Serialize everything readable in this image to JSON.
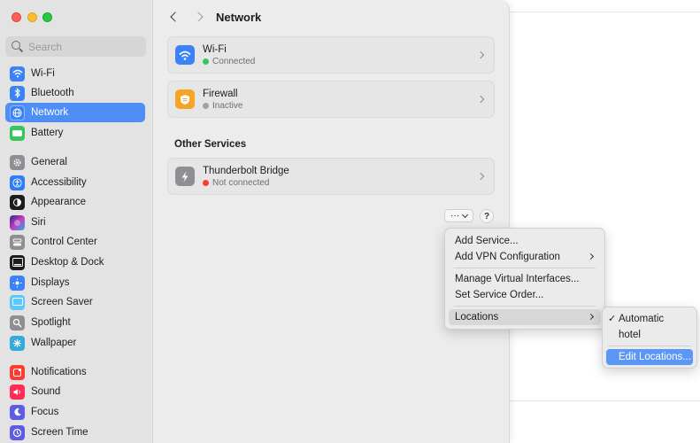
{
  "window": {
    "title": "Network"
  },
  "search": {
    "placeholder": "Search"
  },
  "sidebar": {
    "items": [
      {
        "label": "Wi-Fi",
        "icon": "wifi-icon",
        "color": "#3b82f6"
      },
      {
        "label": "Bluetooth",
        "icon": "bluetooth-icon",
        "color": "#3b82f6"
      },
      {
        "label": "Network",
        "icon": "globe-icon",
        "color": "#3b82f6",
        "selected": true
      },
      {
        "label": "Battery",
        "icon": "battery-icon",
        "color": "#34c759"
      },
      {
        "label": "General",
        "icon": "gear-icon",
        "color": "#8e8e93"
      },
      {
        "label": "Accessibility",
        "icon": "accessibility-icon",
        "color": "#2f7cf6"
      },
      {
        "label": "Appearance",
        "icon": "appearance-icon",
        "color": "#1c1c1e"
      },
      {
        "label": "Siri",
        "icon": "siri-icon",
        "color": "#a64bd6"
      },
      {
        "label": "Control Center",
        "icon": "control-center-icon",
        "color": "#8e8e93"
      },
      {
        "label": "Desktop & Dock",
        "icon": "dock-icon",
        "color": "#1c1c1e"
      },
      {
        "label": "Displays",
        "icon": "displays-icon",
        "color": "#3b82f6"
      },
      {
        "label": "Screen Saver",
        "icon": "screen-saver-icon",
        "color": "#5ac8fa"
      },
      {
        "label": "Spotlight",
        "icon": "spotlight-icon",
        "color": "#8e8e93"
      },
      {
        "label": "Wallpaper",
        "icon": "wallpaper-icon",
        "color": "#34aadc"
      },
      {
        "label": "Notifications",
        "icon": "notifications-icon",
        "color": "#ff3b30"
      },
      {
        "label": "Sound",
        "icon": "sound-icon",
        "color": "#ff2d55"
      },
      {
        "label": "Focus",
        "icon": "focus-icon",
        "color": "#5e5ce6"
      },
      {
        "label": "Screen Time",
        "icon": "screen-time-icon",
        "color": "#5e5ce6"
      }
    ]
  },
  "services": [
    {
      "name": "Wi-Fi",
      "status": "Connected",
      "status_color": "#34c759",
      "icon": "wifi-icon",
      "icon_color": "#3b82f6"
    },
    {
      "name": "Firewall",
      "status": "Inactive",
      "status_color": "#a1a1a1",
      "icon": "firewall-icon",
      "icon_color": "#f5a524"
    }
  ],
  "other_services": {
    "title": "Other Services",
    "items": [
      {
        "name": "Thunderbolt Bridge",
        "status": "Not connected",
        "status_color": "#ff3b30",
        "icon": "thunderbolt-icon",
        "icon_color": "#8e8e93"
      }
    ]
  },
  "actions": {
    "more_label": "···",
    "help_label": "?"
  },
  "menu": {
    "items": [
      {
        "label": "Add Service..."
      },
      {
        "label": "Add VPN Configuration"
      },
      {
        "label": "Manage Virtual Interfaces..."
      },
      {
        "label": "Set Service Order..."
      },
      {
        "label": "Locations"
      }
    ]
  },
  "submenu": {
    "items": [
      {
        "label": "Automatic",
        "checked": true
      },
      {
        "label": "hotel"
      },
      {
        "label": "Edit Locations..."
      }
    ],
    "check": "✓"
  }
}
